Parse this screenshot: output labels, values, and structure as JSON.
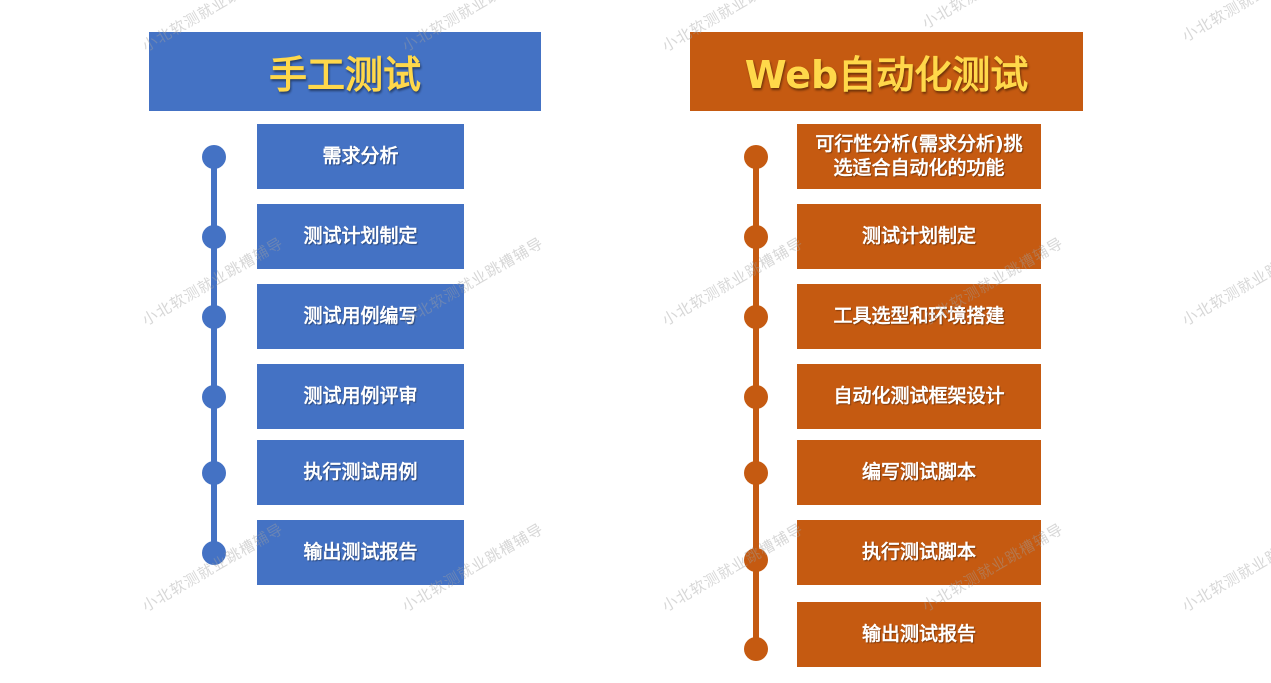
{
  "manual": {
    "title": "手工测试",
    "steps": [
      "需求分析",
      "测试计划制定",
      "测试用例编写",
      "测试用例评审",
      "执行测试用例",
      "输出测试报告"
    ]
  },
  "web": {
    "title": "Web自动化测试",
    "steps": [
      "可行性分析(需求分析)挑选适合自动化的功能",
      "测试计划制定",
      "工具选型和环境搭建",
      "自动化测试框架设计",
      "编写测试脚本",
      "执行测试脚本",
      "输出测试报告"
    ]
  },
  "watermark": {
    "text": "小北软测就业跳槽辅导"
  },
  "colors": {
    "manual_blue": "#4472c4",
    "web_orange": "#c55a11",
    "title_yellow": "#ffd84a"
  }
}
